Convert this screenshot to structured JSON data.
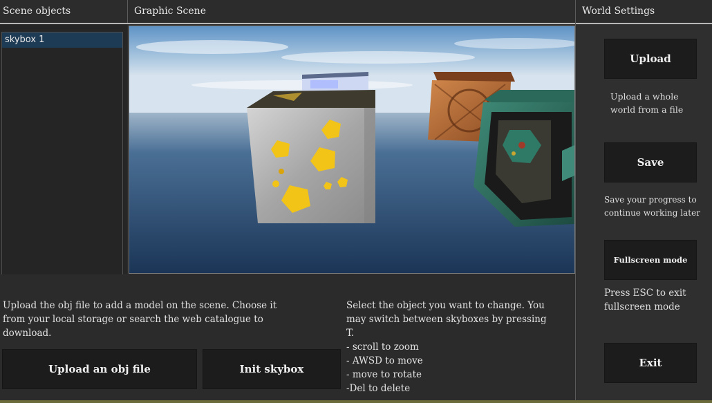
{
  "headers": {
    "scene_objects": "Scene objects",
    "graphic_scene": "Graphic Scene",
    "world_settings": "World Settings"
  },
  "scene_objects": {
    "items": [
      "skybox 1"
    ],
    "selected_index": 0
  },
  "viewport": {
    "icon": "3d-viewport",
    "objects": [
      "gold-ore-cube",
      "crystal-slab",
      "copper-cube",
      "teal-ornate-cube"
    ]
  },
  "bottom": {
    "upload_help": "Upload the obj file to add a model on the scene. Choose it from your local storage or search the web catalogue to download.",
    "controls_help": {
      "intro": "Select the object you want to change. You may switch between skyboxes by pressing T.",
      "lines": [
        "- scroll to zoom",
        "- AWSD to move",
        "- move to rotate",
        "-Del to delete"
      ]
    },
    "upload_obj_label": "Upload an obj file",
    "init_skybox_label": "Init skybox"
  },
  "world_settings": {
    "upload_label": "Upload",
    "upload_desc": "Upload a whole world from a file",
    "save_label": "Save",
    "save_desc": "Save your progress to continue working later",
    "fullscreen_label": "Fullscreen mode",
    "fullscreen_desc": "Press ESC to exit fullscreen mode",
    "exit_label": "Exit"
  },
  "colors": {
    "background": "#2b2b2b",
    "button": "#1c1c1c",
    "selection": "#1e3b55",
    "sky": "#6e9cc8",
    "gold": "#f2c417"
  }
}
